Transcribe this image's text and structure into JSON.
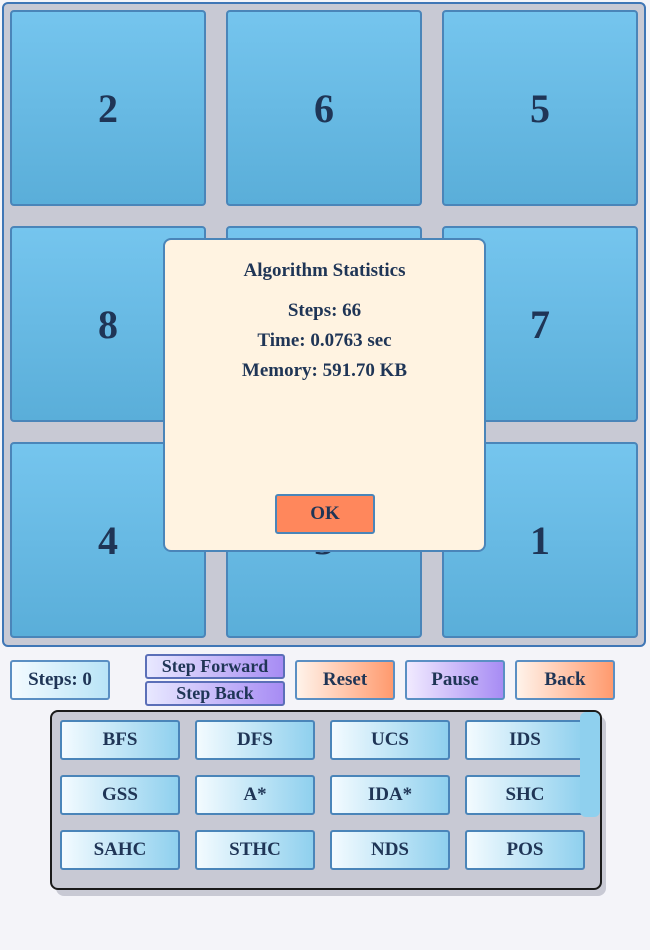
{
  "board": {
    "tiles": [
      "2",
      "6",
      "5",
      "8",
      "",
      "7",
      "4",
      "3",
      "1"
    ]
  },
  "controls": {
    "steps_label": "Steps: 0",
    "step_forward": "Step Forward",
    "step_back": "Step Back",
    "reset": "Reset",
    "pause": "Pause",
    "back": "Back"
  },
  "algorithms": [
    "BFS",
    "DFS",
    "UCS",
    "IDS",
    "GSS",
    "A*",
    "IDA*",
    "SHC",
    "SAHC",
    "STHC",
    "NDS",
    "POS"
  ],
  "dialog": {
    "title": "Algorithm Statistics",
    "steps": "Steps: 66",
    "time": "Time: 0.0763 sec",
    "memory": "Memory: 591.70 KB",
    "ok": "OK"
  },
  "colors": {
    "tile": "#5aaed9",
    "dialog_bg": "#fff3e1",
    "ok": "#ff875c",
    "board_border": "#3f76b6"
  }
}
